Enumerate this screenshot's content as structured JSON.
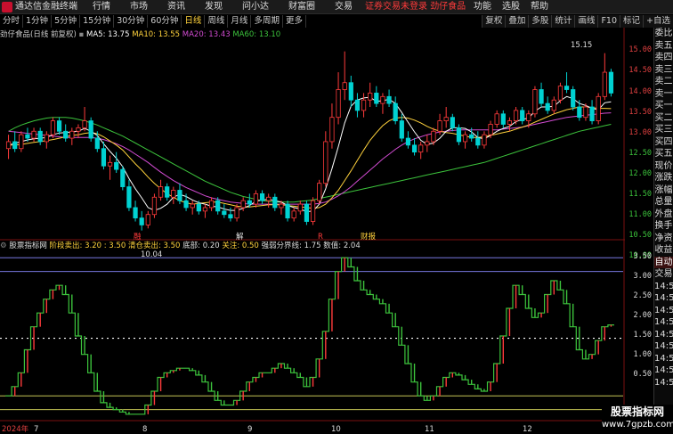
{
  "titlebar": {
    "app_title": "通达信金融终端",
    "menus": [
      "行情",
      "市场",
      "资讯",
      "发现",
      "问小达",
      "财富圈",
      "交易"
    ],
    "notice": "证券交易未登录",
    "stock_name": "劲仔食品",
    "right_menus": [
      "功能",
      "选股",
      "帮助"
    ]
  },
  "toolbar": {
    "periods": [
      "分时",
      "1分钟",
      "5分钟",
      "15分钟",
      "30分钟",
      "60分钟",
      "日线",
      "周线",
      "月线",
      "多周期",
      "更多"
    ],
    "active": "日线",
    "right_tools": [
      "复权",
      "叠加",
      "多股",
      "统计",
      "画线",
      "F10",
      "标记",
      "+自选"
    ]
  },
  "info": {
    "stock_label": "劲仔食品(日线 前复权)",
    "ma5": "MA5: 13.75",
    "ma10": "MA10: 13.55",
    "ma20": "MA20: 13.43",
    "ma60": "MA60: 13.10"
  },
  "price_axis": [
    "15.00",
    "14.50",
    "14.00",
    "13.50",
    "13.00",
    "12.50",
    "12.00",
    "11.50",
    "11.00",
    "10.50",
    "10.00"
  ],
  "annotations": {
    "high": "15.15",
    "low": "10.04",
    "marker1": "融",
    "marker2": "解",
    "marker3": "R",
    "marker4": "财报"
  },
  "sidebar": [
    "委比",
    "卖五",
    "卖四",
    "卖三",
    "卖二",
    "卖一",
    "买一",
    "买二",
    "买三",
    "买四",
    "买五",
    "现价",
    "涨跌",
    "涨幅",
    "总量",
    "外盘",
    "换手",
    "净资",
    "收益",
    "自动",
    "交易"
  ],
  "sidebar_bottom": [
    "14:50",
    "14:50",
    "14:50",
    "14:50",
    "14:50",
    "14:50",
    "14:50",
    "14:50",
    "14:50"
  ],
  "indicator": {
    "name": "股票指标网",
    "v1": "阶段卖出: 3.20 : 3.50",
    "v2": "清仓卖出: 3.50",
    "v3": "底部: 0.20",
    "v4": "关注: 0.50",
    "v5": "强弱分界线: 1.75",
    "v6": "数值: 2.04"
  },
  "ind_axis": [
    "3.50",
    "3.00",
    "2.50",
    "2.00",
    "1.50",
    "1.00",
    "0.50"
  ],
  "date_axis": [
    "2024年",
    "7",
    "8",
    "9",
    "10",
    "11",
    "12"
  ],
  "watermark": {
    "line1": "股票指标网",
    "line2": "www.7gpzb.com"
  },
  "colors": {
    "up": "#ff3b3b",
    "down": "#00d2d2",
    "ma5": "#ffffff",
    "ma10": "#ffd23c",
    "ma20": "#d24bd2",
    "ma60": "#3cc33c"
  },
  "chart_data": {
    "type": "candlestick",
    "y_range": [
      9.8,
      15.5
    ],
    "candles": [
      [
        12.4,
        12.8,
        12.1,
        12.6
      ],
      [
        12.6,
        12.9,
        12.3,
        12.4
      ],
      [
        12.4,
        12.9,
        12.3,
        12.8
      ],
      [
        12.8,
        13.0,
        12.6,
        12.7
      ],
      [
        12.7,
        13.0,
        12.6,
        12.9
      ],
      [
        12.9,
        13.0,
        12.5,
        12.6
      ],
      [
        12.6,
        12.9,
        12.4,
        12.8
      ],
      [
        12.8,
        13.3,
        12.7,
        13.2
      ],
      [
        13.2,
        13.3,
        12.8,
        12.9
      ],
      [
        12.9,
        13.1,
        12.6,
        12.7
      ],
      [
        12.7,
        13.0,
        12.5,
        12.9
      ],
      [
        12.9,
        13.1,
        12.7,
        13.0
      ],
      [
        13.0,
        13.6,
        12.9,
        13.2
      ],
      [
        13.2,
        13.3,
        12.6,
        12.7
      ],
      [
        12.7,
        12.9,
        12.3,
        12.4
      ],
      [
        12.4,
        12.6,
        11.8,
        11.9
      ],
      [
        11.9,
        12.2,
        11.5,
        12.0
      ],
      [
        12.0,
        12.3,
        11.7,
        11.8
      ],
      [
        11.8,
        11.9,
        11.2,
        11.3
      ],
      [
        11.3,
        11.5,
        10.6,
        10.7
      ],
      [
        10.7,
        10.9,
        10.3,
        10.4
      ],
      [
        10.4,
        10.6,
        10.04,
        10.2
      ],
      [
        10.2,
        10.6,
        10.1,
        10.5
      ],
      [
        10.5,
        11.1,
        10.4,
        11.0
      ],
      [
        11.0,
        11.5,
        10.9,
        11.3
      ],
      [
        11.3,
        11.4,
        10.9,
        11.0
      ],
      [
        11.0,
        11.3,
        10.8,
        11.2
      ],
      [
        11.2,
        11.4,
        10.8,
        10.9
      ],
      [
        10.9,
        11.1,
        10.6,
        10.7
      ],
      [
        10.7,
        10.9,
        10.5,
        10.8
      ],
      [
        10.8,
        10.9,
        10.5,
        10.6
      ],
      [
        10.6,
        10.8,
        10.4,
        10.7
      ],
      [
        10.7,
        11.0,
        10.6,
        10.9
      ],
      [
        10.9,
        11.0,
        10.5,
        10.6
      ],
      [
        10.6,
        10.8,
        10.4,
        10.5
      ],
      [
        10.5,
        10.7,
        10.3,
        10.4
      ],
      [
        10.4,
        10.8,
        10.3,
        10.7
      ],
      [
        10.7,
        11.0,
        10.6,
        10.9
      ],
      [
        10.9,
        11.1,
        10.7,
        10.8
      ],
      [
        10.8,
        11.2,
        10.7,
        11.1
      ],
      [
        11.1,
        11.2,
        10.8,
        10.9
      ],
      [
        10.9,
        11.1,
        10.7,
        11.0
      ],
      [
        11.0,
        11.1,
        10.6,
        10.7
      ],
      [
        10.7,
        10.9,
        10.5,
        10.8
      ],
      [
        10.8,
        10.9,
        10.3,
        10.4
      ],
      [
        10.4,
        10.7,
        10.3,
        10.6
      ],
      [
        10.6,
        10.9,
        10.5,
        10.8
      ],
      [
        10.8,
        10.9,
        10.2,
        10.3
      ],
      [
        10.3,
        11.0,
        10.2,
        10.9
      ],
      [
        10.9,
        11.5,
        10.8,
        11.4
      ],
      [
        11.4,
        12.9,
        11.3,
        12.6
      ],
      [
        12.6,
        13.7,
        12.4,
        13.3
      ],
      [
        13.3,
        14.6,
        13.1,
        14.1
      ],
      [
        14.1,
        15.2,
        13.8,
        14.3
      ],
      [
        14.3,
        14.5,
        13.6,
        13.8
      ],
      [
        13.8,
        14.0,
        13.3,
        13.5
      ],
      [
        13.5,
        14.0,
        13.3,
        13.8
      ],
      [
        13.8,
        14.3,
        13.6,
        14.0
      ],
      [
        14.0,
        14.2,
        13.6,
        13.7
      ],
      [
        13.7,
        14.0,
        13.4,
        13.9
      ],
      [
        13.9,
        14.1,
        13.6,
        13.7
      ],
      [
        13.7,
        13.9,
        13.1,
        13.2
      ],
      [
        13.2,
        13.4,
        12.6,
        12.7
      ],
      [
        12.7,
        12.9,
        12.4,
        12.5
      ],
      [
        12.5,
        12.7,
        12.2,
        12.3
      ],
      [
        12.3,
        12.6,
        12.1,
        12.5
      ],
      [
        12.5,
        12.8,
        12.3,
        12.6
      ],
      [
        12.6,
        13.0,
        12.5,
        12.9
      ],
      [
        12.9,
        13.4,
        12.8,
        13.2
      ],
      [
        13.2,
        13.6,
        13.0,
        13.3
      ],
      [
        13.3,
        13.4,
        12.9,
        13.0
      ],
      [
        13.0,
        13.1,
        12.5,
        12.6
      ],
      [
        12.6,
        12.9,
        12.4,
        12.8
      ],
      [
        12.8,
        13.0,
        12.6,
        12.7
      ],
      [
        12.7,
        12.9,
        12.4,
        12.5
      ],
      [
        12.5,
        12.9,
        12.4,
        12.8
      ],
      [
        12.8,
        13.2,
        12.7,
        13.1
      ],
      [
        13.1,
        13.5,
        13.0,
        13.4
      ],
      [
        13.4,
        13.5,
        13.0,
        13.1
      ],
      [
        13.1,
        13.3,
        12.9,
        13.2
      ],
      [
        13.2,
        13.6,
        13.1,
        13.5
      ],
      [
        13.5,
        13.6,
        13.1,
        13.2
      ],
      [
        13.2,
        13.5,
        13.0,
        13.4
      ],
      [
        13.4,
        14.2,
        13.3,
        14.1
      ],
      [
        14.1,
        14.3,
        13.6,
        13.7
      ],
      [
        13.7,
        13.9,
        13.4,
        13.5
      ],
      [
        13.5,
        13.9,
        13.4,
        13.8
      ],
      [
        13.8,
        14.3,
        13.7,
        14.2
      ],
      [
        14.2,
        14.6,
        14.0,
        14.1
      ],
      [
        14.1,
        14.2,
        13.5,
        13.6
      ],
      [
        13.6,
        13.8,
        13.2,
        13.3
      ],
      [
        13.3,
        13.7,
        13.2,
        13.6
      ],
      [
        13.6,
        13.8,
        13.1,
        13.2
      ],
      [
        13.2,
        14.0,
        13.1,
        13.9
      ],
      [
        13.9,
        15.15,
        13.8,
        14.6
      ],
      [
        14.6,
        14.7,
        13.9,
        14.0
      ]
    ],
    "ma5": [
      12.5,
      12.55,
      12.6,
      12.65,
      12.68,
      12.7,
      12.72,
      12.8,
      12.85,
      12.86,
      12.88,
      12.9,
      12.98,
      12.9,
      12.78,
      12.54,
      12.32,
      12.12,
      11.88,
      11.54,
      11.24,
      10.98,
      10.7,
      10.62,
      10.68,
      10.8,
      11.0,
      11.08,
      11.02,
      10.92,
      10.84,
      10.8,
      10.74,
      10.72,
      10.66,
      10.62,
      10.62,
      10.68,
      10.76,
      10.88,
      10.92,
      10.94,
      10.9,
      10.86,
      10.76,
      10.7,
      10.66,
      10.58,
      10.6,
      10.8,
      11.24,
      11.82,
      12.46,
      13.14,
      13.62,
      13.8,
      13.86,
      13.88,
      13.76,
      13.78,
      13.82,
      13.7,
      13.44,
      13.16,
      12.88,
      12.64,
      12.52,
      12.56,
      12.7,
      12.9,
      13.0,
      13.0,
      12.98,
      12.88,
      12.72,
      12.68,
      12.78,
      12.9,
      12.98,
      13.04,
      13.18,
      13.24,
      13.28,
      13.48,
      13.6,
      13.6,
      13.62,
      13.78,
      13.9,
      13.84,
      13.7,
      13.64,
      13.56,
      13.52,
      13.72,
      13.75
    ],
    "ma10": [
      12.5,
      12.5,
      12.52,
      12.55,
      12.58,
      12.6,
      12.63,
      12.66,
      12.7,
      12.74,
      12.78,
      12.8,
      12.84,
      12.86,
      12.83,
      12.74,
      12.62,
      12.5,
      12.36,
      12.16,
      11.96,
      11.78,
      11.58,
      11.4,
      11.24,
      11.1,
      11.0,
      10.9,
      10.84,
      10.8,
      10.82,
      10.84,
      10.86,
      10.86,
      10.82,
      10.78,
      10.74,
      10.72,
      10.72,
      10.74,
      10.76,
      10.78,
      10.78,
      10.78,
      10.76,
      10.74,
      10.72,
      10.7,
      10.68,
      10.7,
      10.8,
      10.98,
      11.2,
      11.48,
      11.76,
      12.06,
      12.36,
      12.64,
      12.86,
      13.06,
      13.2,
      13.28,
      13.3,
      13.28,
      13.22,
      13.14,
      13.04,
      12.96,
      12.9,
      12.86,
      12.84,
      12.8,
      12.76,
      12.72,
      12.72,
      12.74,
      12.78,
      12.82,
      12.86,
      12.9,
      12.96,
      13.02,
      13.08,
      13.16,
      13.24,
      13.32,
      13.4,
      13.46,
      13.52,
      13.56,
      13.6,
      13.6,
      13.58,
      13.56,
      13.56,
      13.55
    ],
    "ma20": [
      12.9,
      12.88,
      12.86,
      12.84,
      12.82,
      12.8,
      12.78,
      12.76,
      12.74,
      12.72,
      12.72,
      12.72,
      12.72,
      12.72,
      12.7,
      12.66,
      12.6,
      12.54,
      12.46,
      12.36,
      12.24,
      12.12,
      12.0,
      11.86,
      11.72,
      11.6,
      11.48,
      11.38,
      11.28,
      11.2,
      11.12,
      11.04,
      10.98,
      10.94,
      10.9,
      10.86,
      10.84,
      10.82,
      10.8,
      10.8,
      10.8,
      10.8,
      10.8,
      10.8,
      10.8,
      10.8,
      10.8,
      10.8,
      10.8,
      10.82,
      10.86,
      10.94,
      11.04,
      11.16,
      11.3,
      11.46,
      11.62,
      11.78,
      11.94,
      12.1,
      12.24,
      12.38,
      12.5,
      12.6,
      12.68,
      12.74,
      12.8,
      12.84,
      12.88,
      12.9,
      12.92,
      12.94,
      12.94,
      12.94,
      12.94,
      12.94,
      12.94,
      12.94,
      12.96,
      12.98,
      13.0,
      13.02,
      13.06,
      13.1,
      13.14,
      13.18,
      13.22,
      13.26,
      13.3,
      13.32,
      13.34,
      13.36,
      13.38,
      13.4,
      13.42,
      13.43
    ],
    "ma60": [
      12.9,
      13.0,
      13.08,
      13.14,
      13.2,
      13.24,
      13.28,
      13.3,
      13.3,
      13.3,
      13.28,
      13.24,
      13.2,
      13.14,
      13.08,
      13.0,
      12.92,
      12.84,
      12.76,
      12.66,
      12.56,
      12.46,
      12.36,
      12.26,
      12.16,
      12.06,
      11.96,
      11.86,
      11.76,
      11.66,
      11.56,
      11.46,
      11.38,
      11.3,
      11.22,
      11.14,
      11.08,
      11.02,
      10.98,
      10.94,
      10.9,
      10.88,
      10.86,
      10.86,
      10.86,
      10.86,
      10.88,
      10.9,
      10.92,
      10.96,
      11.0,
      11.04,
      11.08,
      11.12,
      11.16,
      11.2,
      11.24,
      11.28,
      11.32,
      11.36,
      11.4,
      11.44,
      11.48,
      11.52,
      11.56,
      11.6,
      11.64,
      11.68,
      11.72,
      11.76,
      11.8,
      11.84,
      11.88,
      11.92,
      11.96,
      12.0,
      12.06,
      12.12,
      12.18,
      12.24,
      12.3,
      12.36,
      12.42,
      12.48,
      12.54,
      12.6,
      12.66,
      12.72,
      12.78,
      12.84,
      12.9,
      12.94,
      12.98,
      13.02,
      13.06,
      13.1
    ],
    "indicator": {
      "y_range": [
        0.0,
        3.6
      ],
      "values": [
        0.5,
        0.7,
        1.0,
        1.5,
        2.0,
        2.3,
        2.6,
        2.8,
        2.9,
        2.7,
        2.3,
        1.8,
        1.4,
        1.0,
        0.6,
        0.35,
        0.25,
        0.2,
        0.15,
        0.1,
        0.1,
        0.1,
        0.3,
        0.6,
        0.9,
        1.0,
        1.05,
        1.1,
        1.1,
        1.05,
        0.95,
        0.8,
        0.6,
        0.4,
        0.3,
        0.3,
        0.4,
        0.6,
        0.8,
        0.9,
        1.0,
        1.0,
        1.1,
        1.2,
        1.1,
        1.0,
        0.9,
        0.7,
        0.9,
        1.3,
        1.9,
        2.6,
        3.2,
        3.5,
        3.3,
        3.0,
        2.8,
        2.7,
        2.6,
        2.5,
        2.3,
        2.0,
        1.6,
        1.2,
        0.8,
        0.5,
        0.4,
        0.5,
        0.7,
        0.9,
        1.0,
        0.95,
        0.85,
        0.75,
        0.65,
        0.6,
        0.8,
        1.2,
        1.8,
        2.4,
        2.9,
        2.7,
        2.4,
        2.2,
        2.3,
        2.7,
        3.0,
        2.8,
        2.5,
        2.0,
        1.5,
        1.3,
        1.4,
        1.7,
        2.0,
        2.04
      ]
    }
  }
}
